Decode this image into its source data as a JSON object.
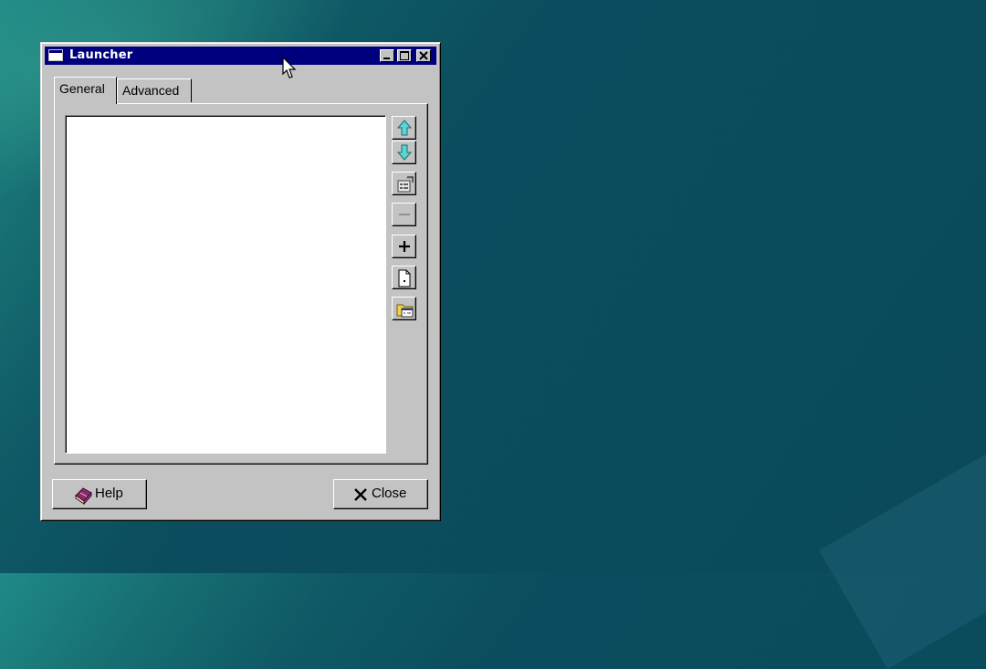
{
  "window": {
    "title": "Launcher",
    "icon": "window-icon"
  },
  "title_buttons": {
    "minimize": "minimize-icon",
    "maximize": "maximize-icon",
    "close": "close-icon"
  },
  "tabs": [
    {
      "label": "General",
      "selected": true
    },
    {
      "label": "Advanced",
      "selected": false
    }
  ],
  "item_list": {
    "items": []
  },
  "side_buttons": [
    {
      "name": "move-up-button",
      "icon": "arrow-up-icon"
    },
    {
      "name": "move-down-button",
      "icon": "arrow-down-icon"
    },
    {
      "name": "properties-button",
      "icon": "properties-icon"
    },
    {
      "name": "remove-item-button",
      "icon": "minus-icon"
    },
    {
      "name": "add-item-button",
      "icon": "plus-icon"
    },
    {
      "name": "new-file-button",
      "icon": "new-document-icon"
    },
    {
      "name": "add-folder-button",
      "icon": "folder-icon"
    }
  ],
  "footer": {
    "help_label": "Help",
    "close_label": "Close"
  },
  "colors": {
    "titlebar": "#00007f",
    "window_face": "#c3c3c3",
    "desktop": "#0a4a5a",
    "arrow_accent": "#5fd3d3"
  }
}
